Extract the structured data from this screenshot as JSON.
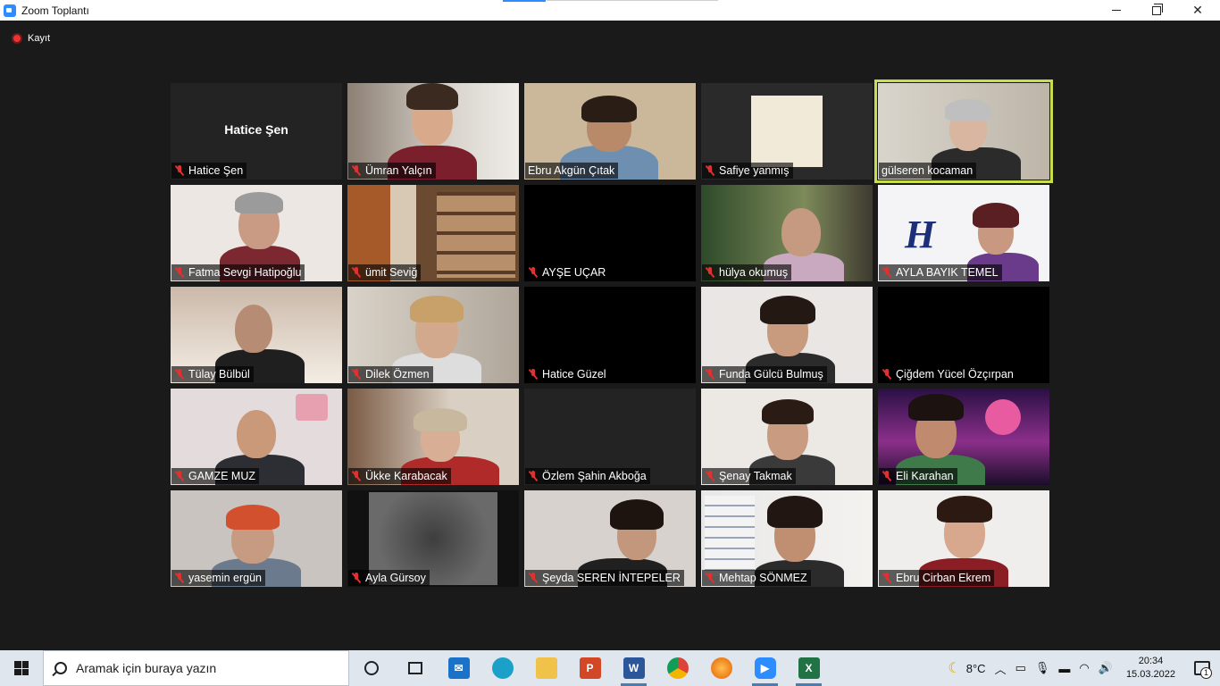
{
  "window": {
    "title": "Zoom Toplantı"
  },
  "recording": {
    "label": "Kayıt"
  },
  "participants": [
    {
      "name": "Hatice Şen",
      "big_name": "Hatice Şen"
    },
    {
      "name": "Ümran Yalçın"
    },
    {
      "name": "Ebru Akgün Çıtak"
    },
    {
      "name": "Safiye yanmış"
    },
    {
      "name": "gülseren kocaman",
      "active_speaker": true
    },
    {
      "name": "Fatma Sevgi Hatipoğlu"
    },
    {
      "name": "ümit Seviğ"
    },
    {
      "name": "AYŞE UÇAR"
    },
    {
      "name": "hülya okumuş"
    },
    {
      "name": "AYLA BAYIK TEMEL"
    },
    {
      "name": "Tülay Bülbül"
    },
    {
      "name": "Dilek Özmen"
    },
    {
      "name": "Hatice Güzel"
    },
    {
      "name": "Funda Gülcü Bulmuş"
    },
    {
      "name": "Çiğdem Yücel Özçırpan"
    },
    {
      "name": "GAMZE MUZ"
    },
    {
      "name": "Ükke Karabacak"
    },
    {
      "name": "Özlem Şahin Akboğa"
    },
    {
      "name": "Şenay Takmak"
    },
    {
      "name": "Eli Karahan"
    },
    {
      "name": "yasemin ergün"
    },
    {
      "name": "Ayla Gürsoy"
    },
    {
      "name": "Şeyda SEREN İNTEPELER"
    },
    {
      "name": "Mehtap SÖNMEZ"
    },
    {
      "name": "Ebru Cirban Ekrem"
    }
  ],
  "taskbar": {
    "search_placeholder": "Aramak için buraya yazın",
    "weather": "8°C",
    "time": "20:34",
    "date": "15.03.2022",
    "notification_count": "1"
  },
  "colors": {
    "active_speaker_border": "#c9de4b",
    "muted_mic": "#e03131",
    "zoom_blue": "#2d8cff"
  }
}
